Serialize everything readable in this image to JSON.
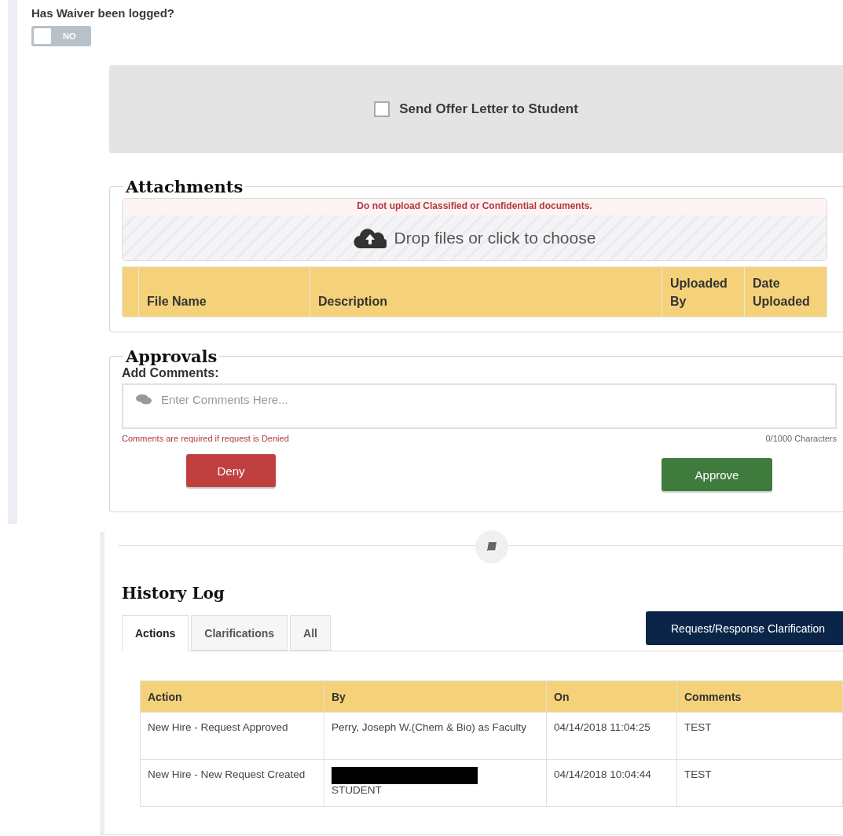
{
  "waiver": {
    "label": "Has Waiver been logged?",
    "toggle": {
      "on": false,
      "label": "NO"
    }
  },
  "offer": {
    "label": "Send Offer Letter to Student",
    "checked": false
  },
  "attachments": {
    "title": "Attachments",
    "warning": "Do not upload Classified or Confidential documents.",
    "dropzone": "Drop files or click to choose",
    "columns": [
      "File Name",
      "Description",
      "Uploaded By",
      "Date Uploaded"
    ]
  },
  "approvals": {
    "title": "Approvals",
    "comments_label": "Add Comments:",
    "placeholder": "Enter Comments Here...",
    "hint": "Comments are required if request is Denied",
    "counter": "0/1000 Characters",
    "buttons": [
      {
        "label": "Deny",
        "kind": "deny"
      },
      {
        "label": "Approve",
        "kind": "approve"
      }
    ]
  },
  "history": {
    "title": "History Log",
    "tabs": [
      {
        "label": "Actions",
        "selected": true
      },
      {
        "label": "Clarifications",
        "selected": false
      },
      {
        "label": "All",
        "selected": false
      }
    ],
    "action_button": "Request/Response Clarification",
    "columns": [
      "Action",
      "By",
      "On",
      "Comments"
    ],
    "rows": [
      {
        "action": "New Hire - Request Approved",
        "by": "Perry, Joseph W.(Chem & Bio) as Faculty",
        "by_redacted": false,
        "on": "04/14/2018 11:04:25",
        "comments": "TEST"
      },
      {
        "action": "New Hire - New Request Created",
        "by": "STUDENT",
        "by_redacted": true,
        "on": "04/14/2018 10:04:44",
        "comments": "TEST"
      }
    ]
  }
}
